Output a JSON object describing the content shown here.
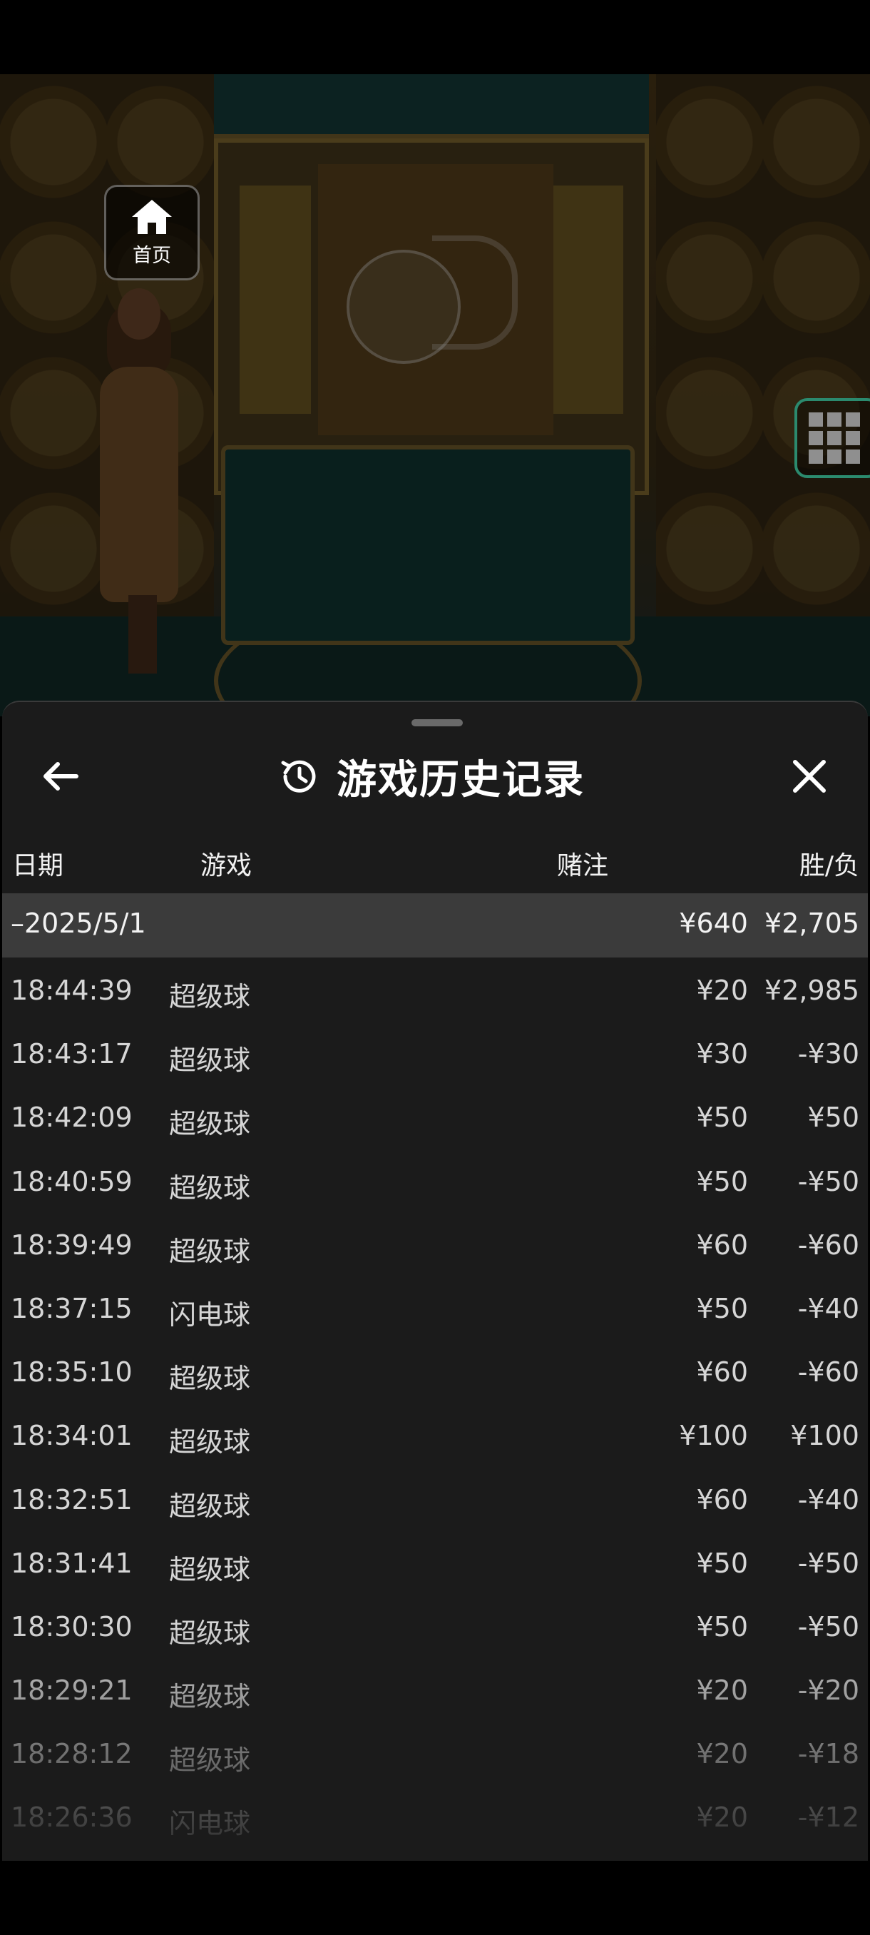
{
  "home": {
    "label": "首页"
  },
  "history": {
    "title": "游戏历史记录",
    "columns": {
      "date": "日期",
      "game": "游戏",
      "bet": "赌注",
      "win_loss": "胜/负"
    },
    "date_group": {
      "date": "–2025/5/1",
      "bet": "¥640",
      "win_loss": "¥2,705"
    },
    "rows": [
      {
        "time": "18:44:39",
        "game": "超级球",
        "bet": "¥20",
        "win_loss": "¥2,985"
      },
      {
        "time": "18:43:17",
        "game": "超级球",
        "bet": "¥30",
        "win_loss": "-¥30"
      },
      {
        "time": "18:42:09",
        "game": "超级球",
        "bet": "¥50",
        "win_loss": "¥50"
      },
      {
        "time": "18:40:59",
        "game": "超级球",
        "bet": "¥50",
        "win_loss": "-¥50"
      },
      {
        "time": "18:39:49",
        "game": "超级球",
        "bet": "¥60",
        "win_loss": "-¥60"
      },
      {
        "time": "18:37:15",
        "game": "闪电球",
        "bet": "¥50",
        "win_loss": "-¥40"
      },
      {
        "time": "18:35:10",
        "game": "超级球",
        "bet": "¥60",
        "win_loss": "-¥60"
      },
      {
        "time": "18:34:01",
        "game": "超级球",
        "bet": "¥100",
        "win_loss": "¥100"
      },
      {
        "time": "18:32:51",
        "game": "超级球",
        "bet": "¥60",
        "win_loss": "-¥40"
      },
      {
        "time": "18:31:41",
        "game": "超级球",
        "bet": "¥50",
        "win_loss": "-¥50"
      },
      {
        "time": "18:30:30",
        "game": "超级球",
        "bet": "¥50",
        "win_loss": "-¥50"
      },
      {
        "time": "18:29:21",
        "game": "超级球",
        "bet": "¥20",
        "win_loss": "-¥20"
      },
      {
        "time": "18:28:12",
        "game": "超级球",
        "bet": "¥20",
        "win_loss": "-¥18"
      },
      {
        "time": "18:26:36",
        "game": "闪电球",
        "bet": "¥20",
        "win_loss": "-¥12"
      }
    ]
  },
  "icons": {
    "home": "home-icon",
    "grid": "grid-icon",
    "back": "arrow-left-icon",
    "history": "history-icon",
    "close": "close-icon"
  },
  "colors": {
    "panel_bg": "#1b1b1b",
    "date_row_bg": "#3b3b3b",
    "grid_border": "#2b8a6e"
  }
}
